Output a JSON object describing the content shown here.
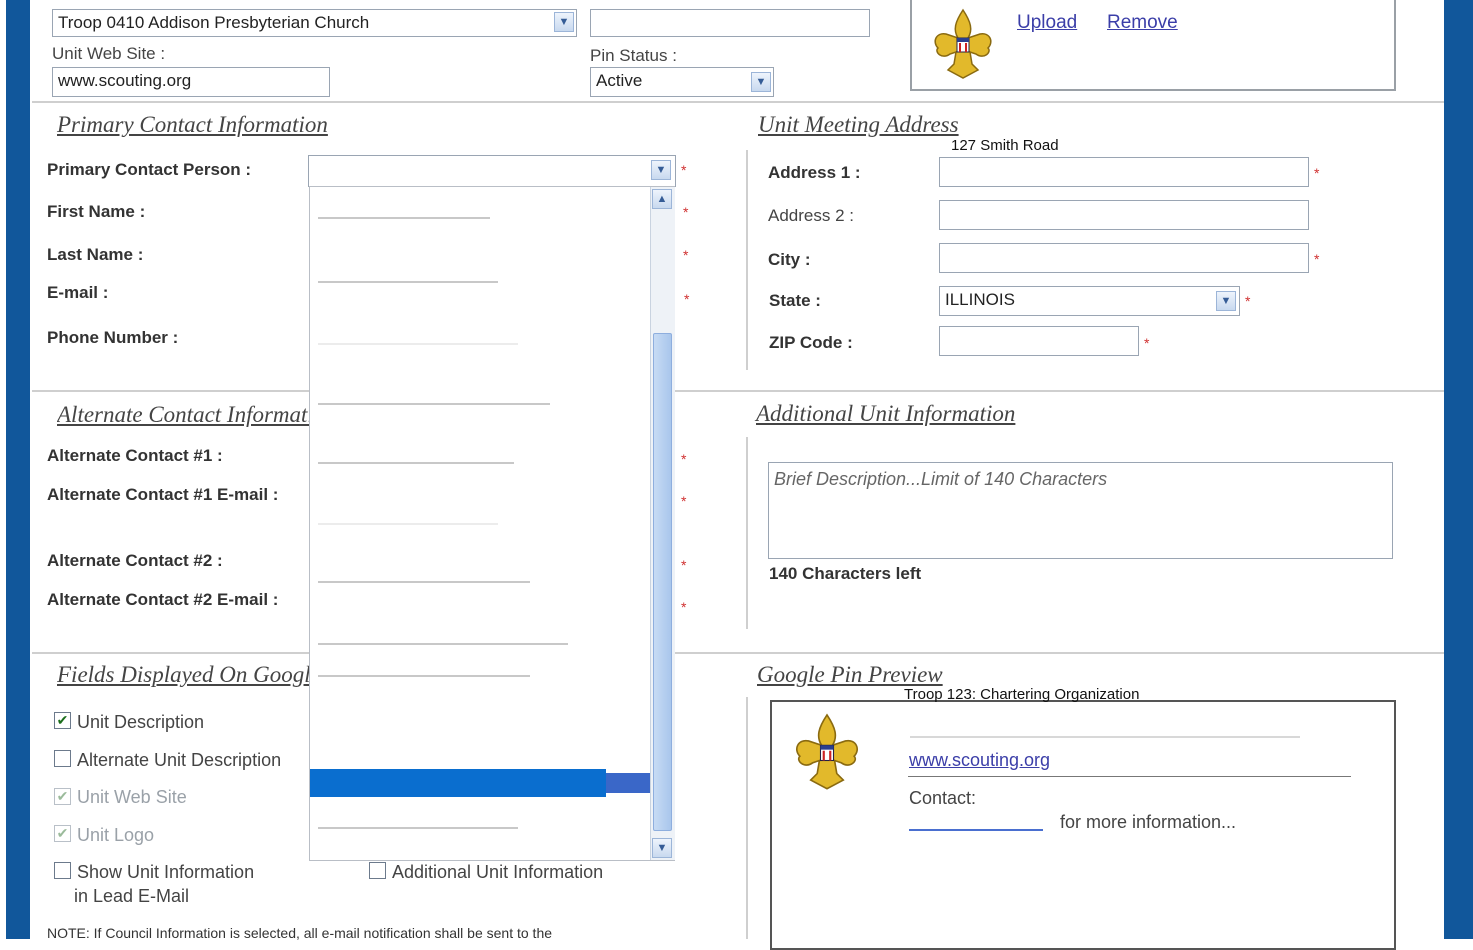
{
  "unit": {
    "chartering_org": "Troop 0410 Addison Presbyterian Church",
    "web_site_label": "Unit Web Site :",
    "web_site_value": "www.scouting.org",
    "pin_status_label": "Pin Status :",
    "pin_status_value": "Active",
    "upload_label": "Upload",
    "remove_label": "Remove"
  },
  "primary_contact": {
    "title": "Primary Contact Information",
    "person_label": "Primary Contact Person :",
    "first_name_label": "First Name :",
    "last_name_label": "Last Name :",
    "email_label": "E-mail :",
    "phone_label": "Phone Number :"
  },
  "meeting_address": {
    "title": "Unit Meeting Address",
    "address_hint": "127 Smith Road",
    "address1_label": "Address 1 :",
    "address2_label": "Address 2 :",
    "city_label": "City :",
    "state_label": "State :",
    "state_value": "ILLINOIS",
    "zip_label": "ZIP Code :"
  },
  "alternate_contact": {
    "title": "Alternate Contact Information",
    "alt1_label": "Alternate Contact #1 :",
    "alt1_email_label": "Alternate Contact #1 E-mail :",
    "alt2_label": "Alternate Contact #2 :",
    "alt2_email_label": "Alternate Contact #2 E-mail :"
  },
  "additional_info": {
    "title": "Additional Unit Information",
    "description_placeholder": "Brief Description...Limit of 140 Characters",
    "chars_left": "140 Characters left"
  },
  "fields_displayed": {
    "title": "Fields Displayed On Google Map",
    "unit_description": "Unit Description",
    "alternate_unit_description": "Alternate Unit Description",
    "unit_web_site": "Unit Web Site",
    "unit_logo": "Unit Logo",
    "show_unit_info_line1": "Show Unit Information",
    "show_unit_info_line2": "in Lead E-Mail",
    "additional_unit_info": "Additional Unit Information",
    "note": "NOTE: If Council Information is selected, all e-mail notification shall be sent to the"
  },
  "pin_preview": {
    "title": "Google Pin Preview",
    "heading": "Troop 123: Chartering Organization",
    "link": "www.scouting.org",
    "contact_label": "Contact:",
    "more_info": "for more information..."
  },
  "colors": {
    "frame_blue": "#11579b",
    "selection_blue": "#0a6ecf",
    "required": "#d03030",
    "link": "#3b3ea8"
  }
}
